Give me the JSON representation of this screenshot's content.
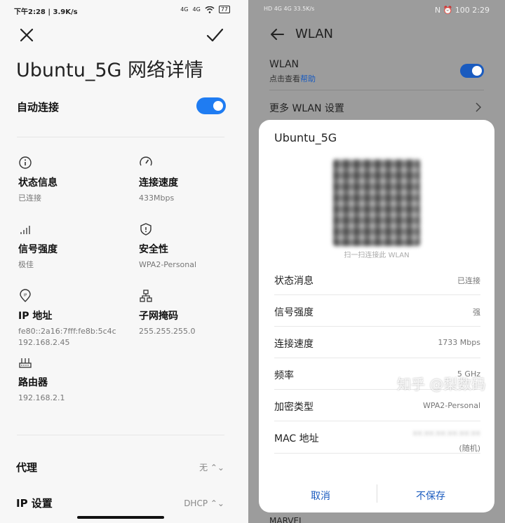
{
  "left": {
    "status_time": "下午2:28 | 3.9K/s",
    "status_signal_1": "4G",
    "status_signal_2": "4G",
    "battery": "77",
    "title": "Ubuntu_5G 网络详情",
    "auto_connect_label": "自动连接",
    "auto_connect_on": true,
    "info": [
      {
        "icon": "info-icon",
        "title": "状态信息",
        "value": "已连接"
      },
      {
        "icon": "speedometer-icon",
        "title": "连接速度",
        "value": "433Mbps"
      },
      {
        "icon": "signal-icon",
        "title": "信号强度",
        "value": "极佳"
      },
      {
        "icon": "shield-icon",
        "title": "安全性",
        "value": "WPA2-Personal"
      },
      {
        "icon": "ip-location-icon",
        "title": "IP 地址",
        "value": "fe80::2a16:7fff:fe8b:5c4c\n192.168.2.45"
      },
      {
        "icon": "subnet-icon",
        "title": "子网掩码",
        "value": "255.255.255.0"
      },
      {
        "icon": "router-icon",
        "title": "路由器",
        "value": "192.168.2.1"
      }
    ],
    "proxy_label": "代理",
    "proxy_value": "无 ⌃⌄",
    "ip_settings_label": "IP 设置",
    "ip_settings_value": "DHCP ⌃⌄"
  },
  "right": {
    "status_left": "HD 4G 4G 33.5K/s",
    "status_right": "N ⏰ 100 2:29",
    "title": "WLAN",
    "wlan_label": "WLAN",
    "help_prefix": "点击查看",
    "help_link": "帮助",
    "wlan_on": true,
    "more_settings": "更多 WLAN 设置",
    "marvel": "MARVEL",
    "dialog": {
      "ssid": "Ubuntu_5G",
      "qr_caption": "扫一扫连接此 WLAN",
      "rows": [
        {
          "key": "状态消息",
          "value": "已连接"
        },
        {
          "key": "信号强度",
          "value": "强"
        },
        {
          "key": "连接速度",
          "value": "1733 Mbps"
        },
        {
          "key": "频率",
          "value": "5 GHz"
        },
        {
          "key": "加密类型",
          "value": "WPA2-Personal"
        }
      ],
      "mac_key": "MAC 地址",
      "mac_value": "xx:xx:xx:xx:xx:xx",
      "mac_note": "(随机)",
      "cancel": "取消",
      "save": "不保存"
    },
    "watermark": "知乎 @梨数码"
  },
  "colors": {
    "accent_left": "#1f7cf2",
    "accent_right": "#1a5bbf"
  }
}
